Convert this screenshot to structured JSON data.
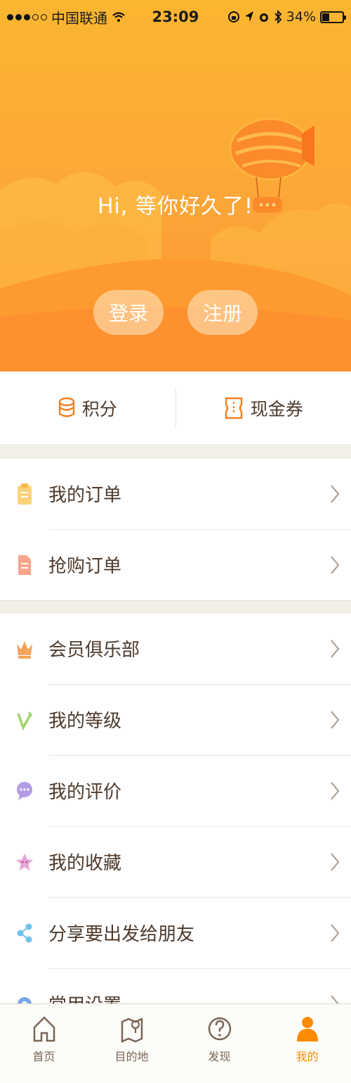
{
  "status_bar": {
    "carrier": "中国联通",
    "time": "23:09",
    "battery": "34%",
    "battery_level": 0.34
  },
  "hero": {
    "greeting": "Hi, 等你好久了!",
    "login_label": "登录",
    "register_label": "注册"
  },
  "points": {
    "points_label": "积分",
    "coupon_label": "现金券"
  },
  "menu_group_1": [
    {
      "label": "我的订单",
      "icon": "clipboard-icon",
      "color": "#fcd27a"
    },
    {
      "label": "抢购订单",
      "icon": "document-icon",
      "color": "#f9a48c"
    }
  ],
  "menu_group_2": [
    {
      "label": "会员俱乐部",
      "icon": "crown-icon",
      "color": "#f5a35a"
    },
    {
      "label": "我的等级",
      "icon": "level-v-icon",
      "color": "#9ed36c"
    },
    {
      "label": "我的评价",
      "icon": "chat-bubble-icon",
      "color": "#b49be6"
    },
    {
      "label": "我的收藏",
      "icon": "star-icon",
      "color": "#e9a5d8"
    },
    {
      "label": "分享要出发给朋友",
      "icon": "share-icon",
      "color": "#6fc3ee"
    },
    {
      "label": "常用设置",
      "icon": "gear-icon",
      "color": "#7aa7e8"
    }
  ],
  "tabbar": [
    {
      "label": "首页",
      "icon": "home-icon",
      "active": false
    },
    {
      "label": "目的地",
      "icon": "map-pin-icon",
      "active": false
    },
    {
      "label": "发现",
      "icon": "compass-question-icon",
      "active": false
    },
    {
      "label": "我的",
      "icon": "person-icon",
      "active": true
    }
  ],
  "colors": {
    "accent": "#fb8b00",
    "hero_top": "#fbb630",
    "hero_bottom": "#fd8f2f",
    "text": "#4d3a2c"
  }
}
